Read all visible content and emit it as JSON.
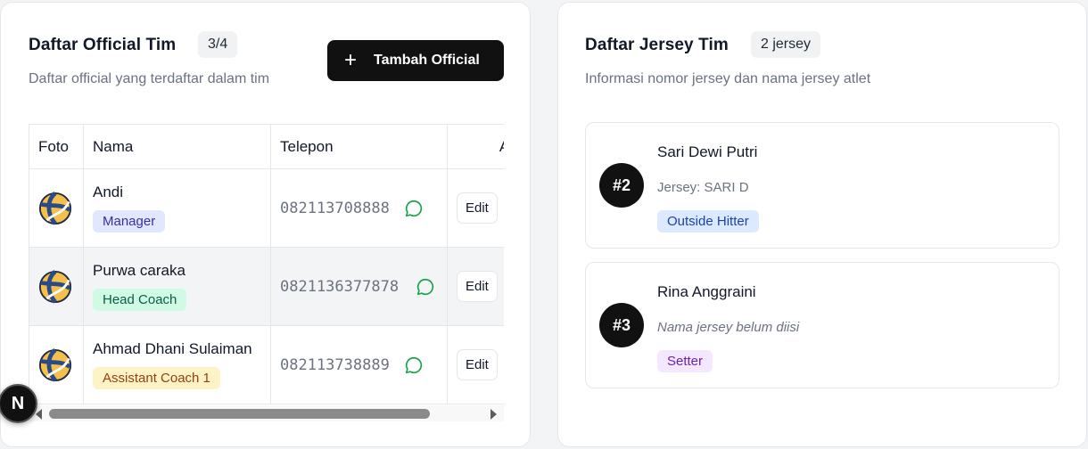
{
  "officials": {
    "title": "Daftar Official Tim",
    "count": "3/4",
    "subtitle": "Daftar official yang terdaftar dalam tim",
    "add_button_label": "Tambah Official",
    "add_icon": "plus-icon",
    "columns": [
      "Foto",
      "Nama",
      "Telepon",
      "Aksi"
    ],
    "rows": [
      {
        "name": "Andi",
        "role": "Manager",
        "phone": "082113708888",
        "action": "Edit"
      },
      {
        "name": "Purwa caraka",
        "role": "Head Coach",
        "phone": "0821136377878",
        "action": "Edit"
      },
      {
        "name": "Ahmad Dhani Sulaiman",
        "role": "Assistant Coach 1",
        "phone": "082113738889",
        "action": "Edit"
      }
    ],
    "photo_icon": "volleyball-icon",
    "phone_icon": "whatsapp-icon"
  },
  "jerseys": {
    "title": "Daftar Jersey Tim",
    "count": "2 jersey",
    "subtitle": "Informasi nomor jersey dan nama jersey atlet",
    "items": [
      {
        "number": "#2",
        "name": "Sari Dewi Putri",
        "jersey": "Jersey: SARI D",
        "position": "Outside Hitter"
      },
      {
        "number": "#3",
        "name": "Rina Anggraini",
        "jersey": "Nama jersey belum diisi",
        "position": "Setter"
      }
    ]
  },
  "dev_badge": {
    "label": "N"
  },
  "colors": {
    "primary_button": "#111111",
    "manager_badge": "#e0e7ff",
    "head_coach_badge": "#d1fae5",
    "assistant_badge": "#fef3c7",
    "outside_hitter_badge": "#dbeafe",
    "setter_badge": "#f3e8ff",
    "whatsapp": "#16a34a"
  }
}
